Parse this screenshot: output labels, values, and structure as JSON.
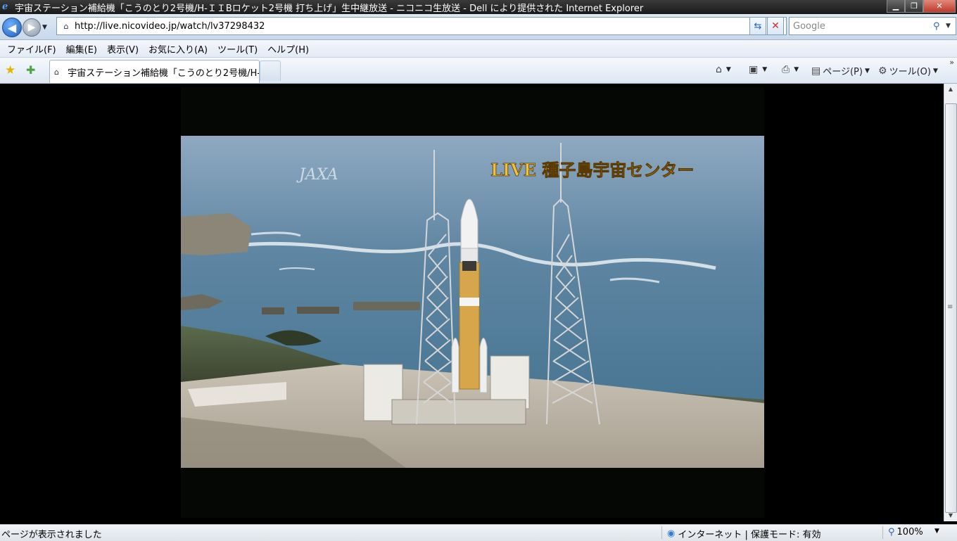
{
  "window": {
    "title": "宇宙ステーション補給機「こうのとり2号機/H-ＩＩBロケット2号機 打ち上げ」生中継放送 - ニコニコ生放送 - Dell により提供された Internet Explorer",
    "icon": "ie-logo-icon"
  },
  "navigation": {
    "address": "http://live.nicovideo.jp/watch/lv37298432",
    "search_placeholder": "Google"
  },
  "menu": {
    "items": [
      "ファイル(F)",
      "編集(E)",
      "表示(V)",
      "お気に入り(A)",
      "ツール(T)",
      "ヘルプ(H)"
    ]
  },
  "tabs": {
    "active_label": "宇宙ステーション補給機「こうのとり2号機/H-..."
  },
  "commandbar": {
    "page_label": "ページ(P)",
    "tools_label": "ツール(O)"
  },
  "video": {
    "logo": "JAXA",
    "live_caption": "LIVE 種子島宇宙センター"
  },
  "status": {
    "message": "ページが表示されました",
    "zone": "インターネット | 保護モード: 有効",
    "zoom": "100%"
  },
  "colors": {
    "sea": "#6b8fa8",
    "sky": "#a9bfd4",
    "tower": "#d8d8d8",
    "caption": "#f0c040"
  }
}
